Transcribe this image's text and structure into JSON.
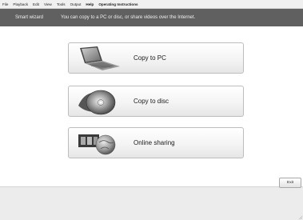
{
  "menubar": {
    "items": [
      {
        "label": "File"
      },
      {
        "label": "Playback"
      },
      {
        "label": "Edit"
      },
      {
        "label": "View"
      },
      {
        "label": "Tools"
      },
      {
        "label": "Output"
      },
      {
        "label": "Help"
      },
      {
        "label": "Operating Instructions"
      }
    ]
  },
  "header": {
    "title": "Smart wizard",
    "message": "You can copy to a PC or disc, or share videos over the Internet."
  },
  "actions": [
    {
      "label": "Copy to PC",
      "icon": "laptop-icon"
    },
    {
      "label": "Copy to disc",
      "icon": "disc-icon"
    },
    {
      "label": "Online sharing",
      "icon": "globe-film-icon"
    }
  ],
  "footer": {
    "exit_label": "Exit"
  },
  "colors": {
    "header_bg": "#606060",
    "header_text": "#f0f0f0",
    "button_border": "#bdbdbd",
    "footer_bg": "#ececec"
  }
}
